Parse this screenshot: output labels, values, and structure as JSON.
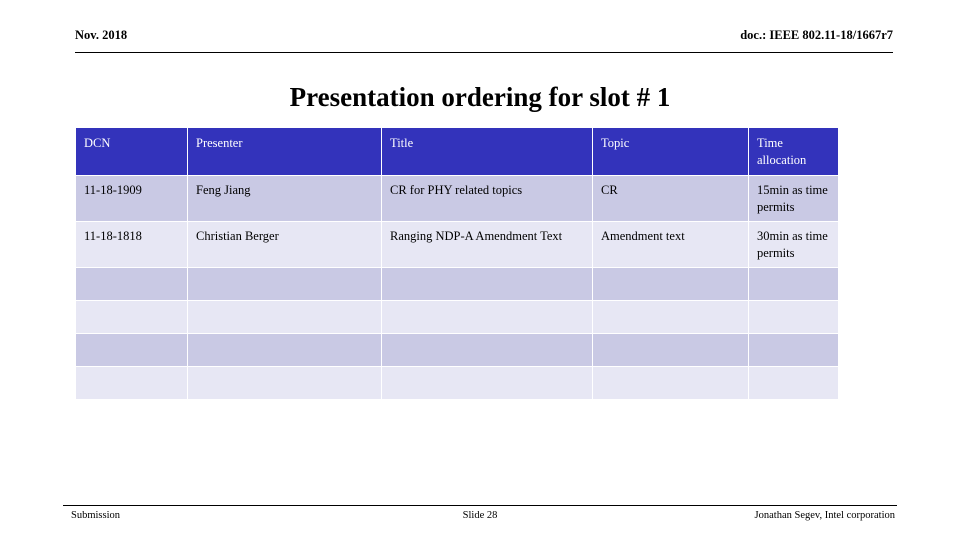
{
  "header": {
    "left": "Nov. 2018",
    "right": "doc.: IEEE 802.11-18/1667r7"
  },
  "title": "Presentation ordering for slot # 1",
  "table": {
    "columns": [
      "DCN",
      "Presenter",
      "Title",
      "Topic",
      "Time allocation"
    ],
    "header_bg": "#3333BB",
    "header_fg": "#FFFFFF",
    "row_bg_dark": "#C9C9E4",
    "row_bg_light": "#E7E7F4",
    "rows": [
      {
        "dcn": "11-18-1909",
        "presenter": "Feng Jiang",
        "title": "CR for PHY related topics",
        "topic": "CR",
        "time": "15min as time permits"
      },
      {
        "dcn": "11-18-1818",
        "presenter": "Christian Berger",
        "title": "Ranging NDP-A Amendment Text",
        "topic": "Amendment text",
        "time": "30min as time permits"
      },
      {
        "dcn": "",
        "presenter": "",
        "title": "",
        "topic": "",
        "time": ""
      },
      {
        "dcn": "",
        "presenter": "",
        "title": "",
        "topic": "",
        "time": ""
      },
      {
        "dcn": "",
        "presenter": "",
        "title": "",
        "topic": "",
        "time": ""
      },
      {
        "dcn": "",
        "presenter": "",
        "title": "",
        "topic": "",
        "time": ""
      }
    ]
  },
  "footer": {
    "left": "Submission",
    "center": "Slide 28",
    "right": "Jonathan Segev, Intel corporation"
  }
}
